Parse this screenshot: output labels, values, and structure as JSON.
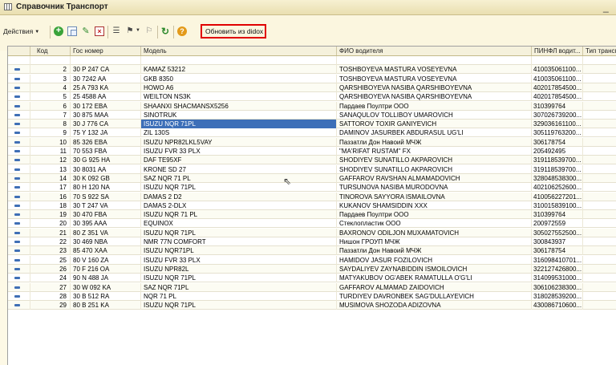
{
  "window": {
    "title": "Справочник  Транспорт",
    "minimize": "_"
  },
  "toolbar": {
    "actions_label": "Действия",
    "update_label": "Обновить из didox"
  },
  "columns": [
    "Код",
    "Гос номер",
    "Модель",
    "ФИО водителя",
    "ПИНФЛ водит...",
    "Тип трансп"
  ],
  "rows": [
    {
      "code": "",
      "gos": "",
      "model": "",
      "fio": "",
      "pinfl": ""
    },
    {
      "code": "2",
      "gos": "30 P 247 CA",
      "model": "KAMAZ 53212",
      "fio": "TOSHBOYEVA MASTURA VOSEYEVNA",
      "pinfl": "410035061100..."
    },
    {
      "code": "3",
      "gos": "30 7242 AA",
      "model": "GKB 8350",
      "fio": "TOSHBOYEVA MASTURA VOSEYEVNA",
      "pinfl": "410035061100..."
    },
    {
      "code": "4",
      "gos": "25 A 793 KA",
      "model": "HOWO A6",
      "fio": "QARSHIBOYEVA NASIBA QARSHIBOYEVNA",
      "pinfl": "402017854500..."
    },
    {
      "code": "5",
      "gos": "25 4588 AA",
      "model": "WEILTON NS3K",
      "fio": "QARSHIBOYEVA NASIBA QARSHIBOYEVNA",
      "pinfl": "402017854500..."
    },
    {
      "code": "6",
      "gos": "30 172 EBA",
      "model": "SHAANXI SHACMANSX5256",
      "fio": "Пардаев Поултри ООО",
      "pinfl": "310399764"
    },
    {
      "code": "7",
      "gos": "30 875 MAA",
      "model": "SINOTRUK",
      "fio": "SANAQULOV TOLLIBOY UMAROVICH",
      "pinfl": "307026739200..."
    },
    {
      "code": "8",
      "gos": "30 J 776 CA",
      "model": "ISUZU NQR 71PL",
      "fio": "SATTOROV TOXIR GANIYEVICH",
      "pinfl": "329036161100..."
    },
    {
      "code": "9",
      "gos": "75 Y 132 JA",
      "model": "ZIL 130S",
      "fio": "DAMINOV JASURBEK ABDURASUL UG'LI",
      "pinfl": "305119763200..."
    },
    {
      "code": "10",
      "gos": "85 326 EBA",
      "model": "ISUZU NPR82LKL5VAY",
      "fio": "Паззатли Дон Навоий  МЧЖ",
      "pinfl": "306178754"
    },
    {
      "code": "11",
      "gos": "70 553 FBA",
      "model": "ISUZU FVR 33 PLX",
      "fio": "\"MA'RIFAT RUSTAM\" FX",
      "pinfl": "205492495"
    },
    {
      "code": "12",
      "gos": "30 G 925 HA",
      "model": "DAF TE95XF",
      "fio": "SHODIYEV SUNATILLO AKPAROVICH",
      "pinfl": "319118539700..."
    },
    {
      "code": "13",
      "gos": "30 8031 AA",
      "model": "KRONE SD 27",
      "fio": "SHODIYEV SUNATILLO AKPAROVICH",
      "pinfl": "319118539700..."
    },
    {
      "code": "14",
      "gos": "30 K 092 GB",
      "model": "SAZ NQR 71 PL",
      "fio": "GAFFAROV RAVSHAN ALMAMADOVICH",
      "pinfl": "328048538300..."
    },
    {
      "code": "17",
      "gos": "80 H 120 NA",
      "model": "ISUZU NQR 71PL",
      "fio": "TURSUNOVA NASIBA MURODOVNA",
      "pinfl": "402106252600..."
    },
    {
      "code": "16",
      "gos": "70 S 922 SA",
      "model": "DAMAS 2 D2",
      "fio": "TINOROVA SAYYORA ISMAILOVNA",
      "pinfl": "410056227201..."
    },
    {
      "code": "18",
      "gos": "30 T 247 VA",
      "model": "DAMAS 2-DLX",
      "fio": "KUKANOV SHAMSIDDIN XXX",
      "pinfl": "310015839100..."
    },
    {
      "code": "19",
      "gos": "30 470 FBA",
      "model": "ISUZU NQR 71 PL",
      "fio": "Пардаев Поултри ООО",
      "pinfl": "310399764"
    },
    {
      "code": "20",
      "gos": "30 395 AAA",
      "model": "EQUINOX",
      "fio": "Стеклопластик ООО",
      "pinfl": "200972559"
    },
    {
      "code": "21",
      "gos": "80 Z 351 VA",
      "model": "ISUZU NQR 71PL",
      "fio": "BAXRONOV ODILJON MUXAMATOVICH",
      "pinfl": "305027552500..."
    },
    {
      "code": "22",
      "gos": "30 469 NBA",
      "model": "NMR 77N COMFORT",
      "fio": "Нишон ГРОУП МЧЖ",
      "pinfl": "300843937"
    },
    {
      "code": "23",
      "gos": "85 470 XAA",
      "model": "ISUZU NQR71PL",
      "fio": "Паззатли Дон Навоий  МЧЖ",
      "pinfl": "306178754"
    },
    {
      "code": "25",
      "gos": "80 V 160 ZA",
      "model": "ISUZU FVR 33 PLX",
      "fio": "HAMIDOV JASUR FOZILOVICH",
      "pinfl": "316098410701..."
    },
    {
      "code": "26",
      "gos": "70 F 216 OA",
      "model": "ISUZU NPR82L",
      "fio": "SAYDALIYEV ZAYNABIDDIN ISMOILOVICH",
      "pinfl": "322127426800..."
    },
    {
      "code": "24",
      "gos": "90 N 488 JA",
      "model": "ISUZU NQR 71PL",
      "fio": "MATYAKUBOV OG'ABEK RAMATULLA O'G'LI",
      "pinfl": "314099531000..."
    },
    {
      "code": "27",
      "gos": "30 W 092 KA",
      "model": "SAZ NQR 71PL",
      "fio": "GAFFAROV ALMAMAD ZAIDOVICH",
      "pinfl": "306106238300..."
    },
    {
      "code": "28",
      "gos": "30 B 512 RA",
      "model": "NQR 71 PL",
      "fio": "TURDIYEV DAVRONBEK SAG'DULLAYEVICH",
      "pinfl": "318028539200..."
    },
    {
      "code": "29",
      "gos": "80 B 251 KA",
      "model": "ISUZU NQR 71PL",
      "fio": "MUSIMOVA SHOZODA ADIZOVNA",
      "pinfl": "430086710600..."
    }
  ],
  "colors": {
    "selection": "#3d6fb8",
    "highlight_box": "#e00000",
    "background": "#fdf9e6"
  }
}
